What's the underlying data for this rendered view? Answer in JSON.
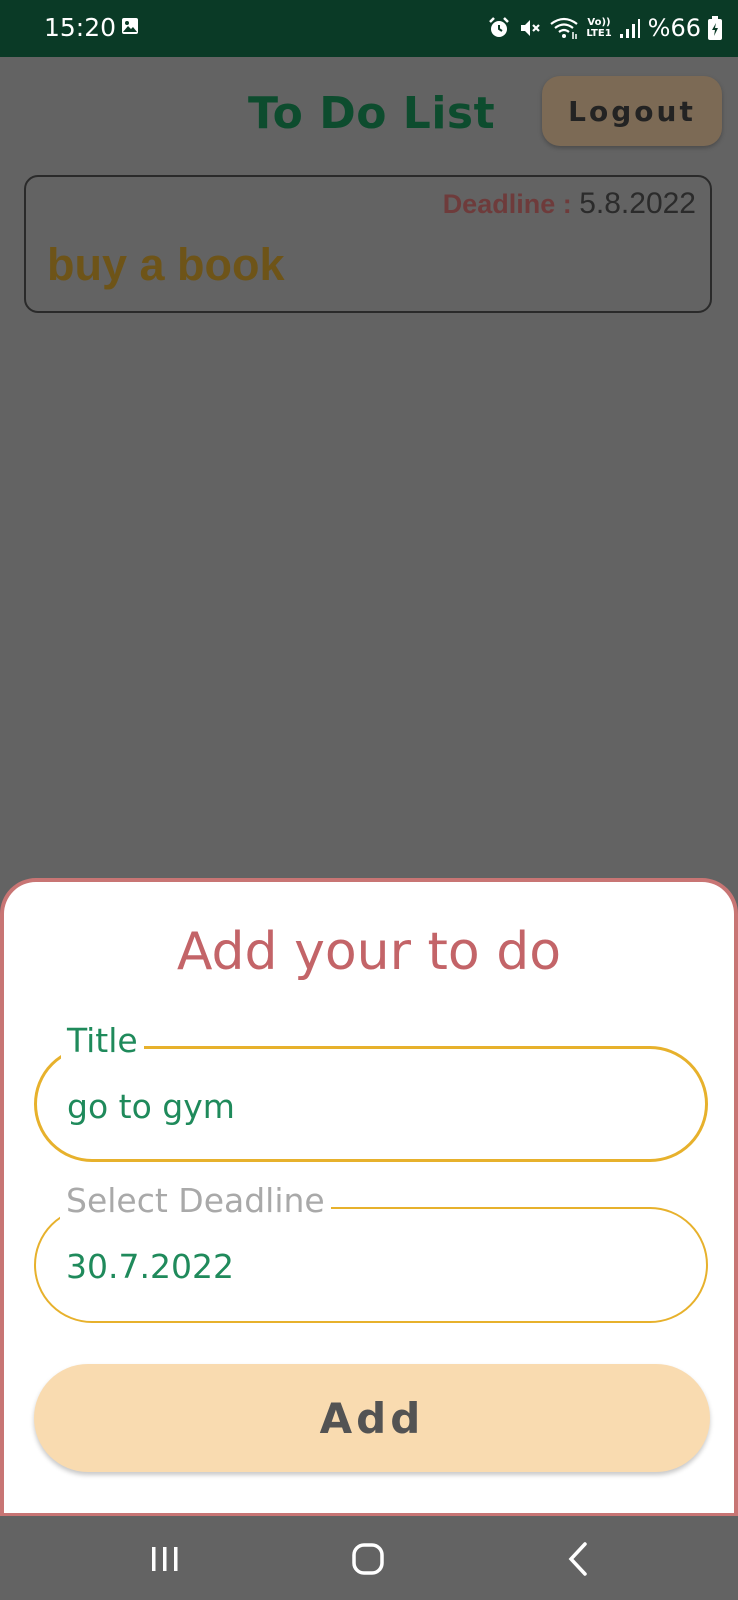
{
  "status_bar": {
    "time": "15:20",
    "battery_text": "%66",
    "icons": [
      "gallery-icon",
      "alarm-icon",
      "mute-icon",
      "wifi-icon",
      "volte-icon",
      "signal-icon",
      "battery-icon"
    ],
    "volte_top": "Vo))",
    "volte_bottom": "LTE1"
  },
  "header": {
    "title": "To Do List",
    "logout_label": "Logout"
  },
  "todos": [
    {
      "title": "buy a book",
      "deadline_label": "Deadline : ",
      "deadline_value": "5.8.2022"
    }
  ],
  "sheet": {
    "title": "Add your to do",
    "title_field": {
      "label": "Title",
      "value": "go to gym"
    },
    "deadline_field": {
      "label": "Select Deadline",
      "value": "30.7.2022"
    },
    "add_label": "Add"
  },
  "nav": {
    "icons": [
      "recents-icon",
      "home-icon",
      "back-icon"
    ]
  },
  "colors": {
    "status_bar": "#0a3a26",
    "overlay_bg": "#636363",
    "sheet_border": "#c87574",
    "field_border": "#e7b12c",
    "accent_green": "#1f8a5b",
    "add_button": "#f9dbb0"
  }
}
